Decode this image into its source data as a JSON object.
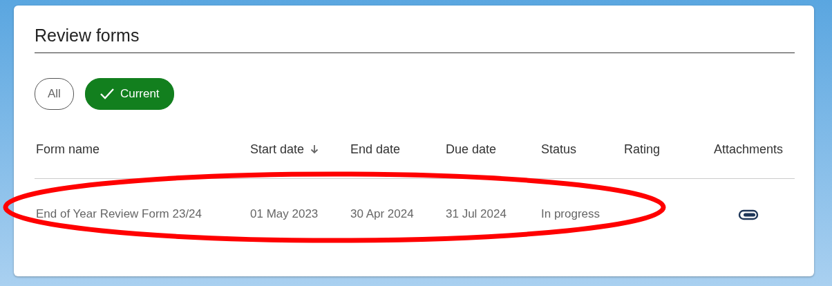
{
  "title": "Review forms",
  "filters": [
    {
      "label": "All",
      "selected": false
    },
    {
      "label": "Current",
      "selected": true
    }
  ],
  "table": {
    "columns": [
      {
        "label": "Form name",
        "sorted": false
      },
      {
        "label": "Start date",
        "sorted": true
      },
      {
        "label": "End date",
        "sorted": false
      },
      {
        "label": "Due date",
        "sorted": false
      },
      {
        "label": "Status",
        "sorted": false
      },
      {
        "label": "Rating",
        "sorted": false
      },
      {
        "label": "Attachments",
        "sorted": false
      }
    ],
    "rows": [
      {
        "cells": [
          "End of Year Review Form 23/24",
          "01 May 2023",
          "30 Apr 2024",
          "31 Jul 2024",
          "In progress"
        ],
        "attachment": true
      }
    ]
  },
  "annotation": {
    "kind": "ellipse"
  }
}
